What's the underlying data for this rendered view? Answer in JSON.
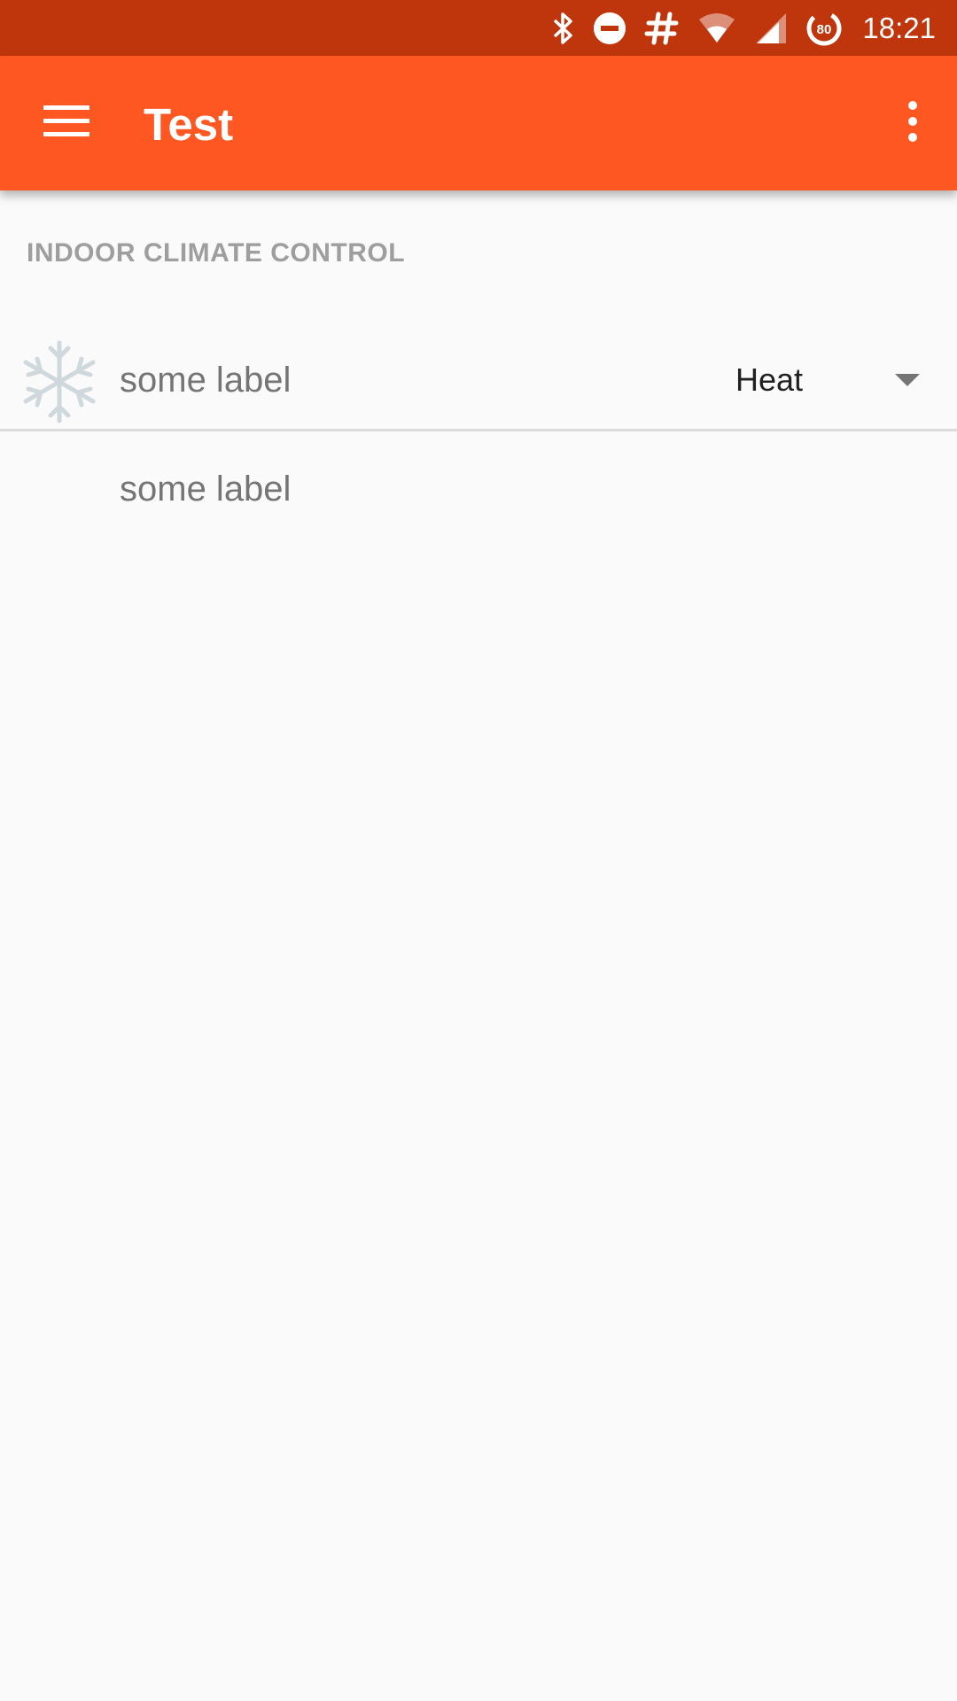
{
  "status_bar": {
    "time": "18:21",
    "battery_level": "80",
    "icons": [
      "bluetooth-icon",
      "do-not-disturb-icon",
      "hashtag-icon",
      "wifi-icon",
      "cell-signal-icon",
      "battery-saver-icon"
    ],
    "color": "#bf360c"
  },
  "app_bar": {
    "title": "Test",
    "color": "#ff5722",
    "menu_icon": "hamburger-menu-icon",
    "overflow_icon": "more-vert-icon"
  },
  "content": {
    "section_header": "INDOOR CLIMATE CONTROL",
    "rows": [
      {
        "icon": "snowflake-icon",
        "label": "some label",
        "spinner_value": "Heat"
      },
      {
        "label": "some label"
      }
    ]
  }
}
